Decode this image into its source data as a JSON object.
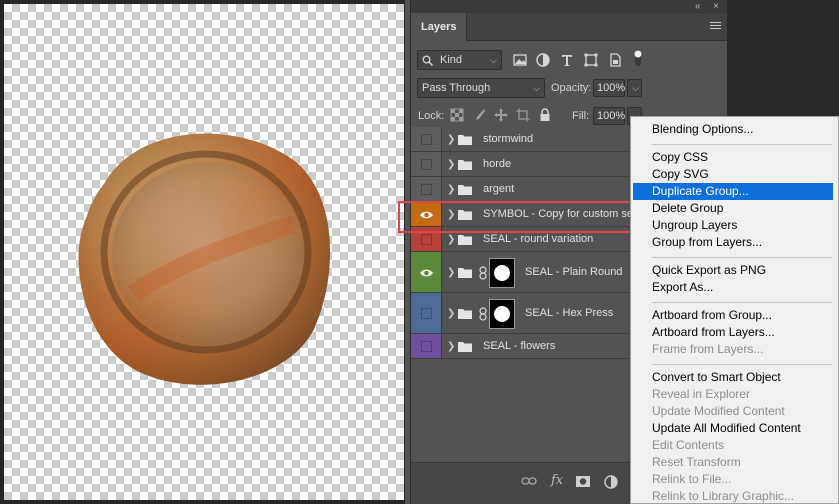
{
  "panel": {
    "tab_label": "Layers",
    "collapse_glyph": "«",
    "close_glyph": "×"
  },
  "filter": {
    "kind_label": "Kind",
    "icons": [
      "pixel-filter-icon",
      "adjustment-filter-icon",
      "type-filter-icon",
      "shape-filter-icon",
      "smart-object-filter-icon"
    ]
  },
  "blend": {
    "mode": "Pass Through",
    "opacity_label": "Opacity:",
    "opacity_value": "100%",
    "lock_label": "Lock:",
    "fill_label": "Fill:",
    "fill_value": "100%"
  },
  "layers": [
    {
      "name": "stormwind",
      "visible": false,
      "color": "#5d5d5d",
      "selected": false,
      "has_mask": false
    },
    {
      "name": "horde",
      "visible": false,
      "color": "#5d5d5d",
      "selected": false,
      "has_mask": false
    },
    {
      "name": "argent",
      "visible": false,
      "color": "#5d5d5d",
      "selected": false,
      "has_mask": false
    },
    {
      "name": "SYMBOL - Copy for custom seals",
      "visible": true,
      "color": "#c46a12",
      "selected": true,
      "has_mask": false
    },
    {
      "name": "SEAL - round variation",
      "visible": false,
      "color": "#b8413a",
      "selected": false,
      "has_mask": false
    },
    {
      "name": "SEAL - Plain Round",
      "visible": true,
      "color": "#5a8a3a",
      "selected": false,
      "has_mask": true
    },
    {
      "name": "SEAL - Hex Press",
      "visible": false,
      "color": "#4c6a96",
      "selected": false,
      "has_mask": true
    },
    {
      "name": "SEAL - flowers",
      "visible": false,
      "color": "#6d4f9e",
      "selected": false,
      "has_mask": false
    }
  ],
  "bottom_toolbar": [
    "link-layers-icon",
    "fx-icon",
    "add-mask-icon",
    "adjustment-layer-icon"
  ],
  "context_menu": [
    {
      "label": "Blending Options...",
      "enabled": true,
      "highlighted": false
    },
    {
      "separator": true
    },
    {
      "label": "Copy CSS",
      "enabled": true,
      "highlighted": false
    },
    {
      "label": "Copy SVG",
      "enabled": true,
      "highlighted": false
    },
    {
      "label": "Duplicate Group...",
      "enabled": true,
      "highlighted": true
    },
    {
      "label": "Delete Group",
      "enabled": true,
      "highlighted": false
    },
    {
      "label": "Ungroup Layers",
      "enabled": true,
      "highlighted": false
    },
    {
      "label": "Group from Layers...",
      "enabled": true,
      "highlighted": false
    },
    {
      "separator": true
    },
    {
      "label": "Quick Export as PNG",
      "enabled": true,
      "highlighted": false
    },
    {
      "label": "Export As...",
      "enabled": true,
      "highlighted": false
    },
    {
      "separator": true
    },
    {
      "label": "Artboard from Group...",
      "enabled": true,
      "highlighted": false
    },
    {
      "label": "Artboard from Layers...",
      "enabled": true,
      "highlighted": false
    },
    {
      "label": "Frame from Layers...",
      "enabled": false,
      "highlighted": false
    },
    {
      "separator": true
    },
    {
      "label": "Convert to Smart Object",
      "enabled": true,
      "highlighted": false
    },
    {
      "label": "Reveal in Explorer",
      "enabled": false,
      "highlighted": false
    },
    {
      "label": "Update Modified Content",
      "enabled": false,
      "highlighted": false
    },
    {
      "label": "Update All Modified Content",
      "enabled": true,
      "highlighted": false
    },
    {
      "label": "Edit Contents",
      "enabled": false,
      "highlighted": false
    },
    {
      "label": "Reset Transform",
      "enabled": false,
      "highlighted": false
    },
    {
      "label": "Relink to File...",
      "enabled": false,
      "highlighted": false
    },
    {
      "label": "Relink to Library Graphic...",
      "enabled": false,
      "highlighted": false
    }
  ],
  "colors": {
    "menu_highlight": "#0f6fd8",
    "annotation": "#e0434b"
  }
}
